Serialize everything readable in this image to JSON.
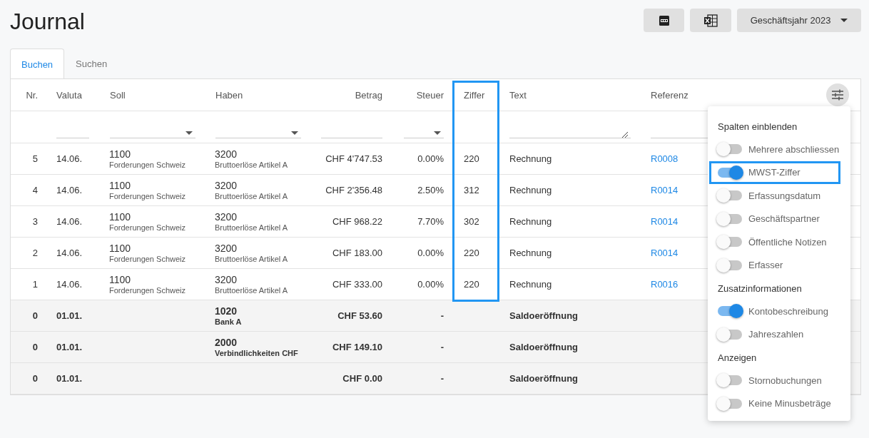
{
  "page": {
    "title": "Journal"
  },
  "toolbar": {
    "year_select": "Geschäftsjahr 2023"
  },
  "tabs": [
    {
      "label": "Buchen",
      "selected": true
    },
    {
      "label": "Suchen",
      "selected": false
    }
  ],
  "table": {
    "columns": [
      {
        "label": "Nr.",
        "kind": "none",
        "highlighted": false
      },
      {
        "label": "Valuta",
        "kind": "text",
        "highlighted": false
      },
      {
        "label": "Soll",
        "kind": "select",
        "highlighted": false
      },
      {
        "label": "Haben",
        "kind": "select",
        "highlighted": false
      },
      {
        "label": "Betrag",
        "kind": "text",
        "highlighted": false
      },
      {
        "label": "Steuer",
        "kind": "select",
        "highlighted": false
      },
      {
        "label": "Ziffer",
        "kind": "none",
        "highlighted": true
      },
      {
        "label": "Text",
        "kind": "textarea",
        "highlighted": false
      },
      {
        "label": "Referenz",
        "kind": "text",
        "highlighted": false
      }
    ],
    "rows": [
      {
        "kind": "entry",
        "nr": "5",
        "valuta": "14.06.",
        "soll": {
          "number": "1100",
          "name": "Forderungen Schweiz"
        },
        "haben": {
          "number": "3200",
          "name": "Bruttoerlöse Artikel A"
        },
        "betrag": "CHF 4'747.53",
        "steuer": "0.00%",
        "ziffer": "220",
        "text": "Rechnung",
        "referenz": "R0008"
      },
      {
        "kind": "entry",
        "nr": "4",
        "valuta": "14.06.",
        "soll": {
          "number": "1100",
          "name": "Forderungen Schweiz"
        },
        "haben": {
          "number": "3200",
          "name": "Bruttoerlöse Artikel A"
        },
        "betrag": "CHF 2'356.48",
        "steuer": "2.50%",
        "ziffer": "312",
        "text": "Rechnung",
        "referenz": "R0014"
      },
      {
        "kind": "entry",
        "nr": "3",
        "valuta": "14.06.",
        "soll": {
          "number": "1100",
          "name": "Forderungen Schweiz"
        },
        "haben": {
          "number": "3200",
          "name": "Bruttoerlöse Artikel A"
        },
        "betrag": "CHF 968.22",
        "steuer": "7.70%",
        "ziffer": "302",
        "text": "Rechnung",
        "referenz": "R0014"
      },
      {
        "kind": "entry",
        "nr": "2",
        "valuta": "14.06.",
        "soll": {
          "number": "1100",
          "name": "Forderungen Schweiz"
        },
        "haben": {
          "number": "3200",
          "name": "Bruttoerlöse Artikel A"
        },
        "betrag": "CHF 183.00",
        "steuer": "0.00%",
        "ziffer": "220",
        "text": "Rechnung",
        "referenz": "R0014"
      },
      {
        "kind": "entry",
        "nr": "1",
        "valuta": "14.06.",
        "soll": {
          "number": "1100",
          "name": "Forderungen Schweiz"
        },
        "haben": {
          "number": "3200",
          "name": "Bruttoerlöse Artikel A"
        },
        "betrag": "CHF 333.00",
        "steuer": "0.00%",
        "ziffer": "220",
        "text": "Rechnung",
        "referenz": "R0016"
      },
      {
        "kind": "opening",
        "nr": "0",
        "valuta": "01.01.",
        "haben": {
          "number": "1020",
          "name": "Bank A"
        },
        "betrag": "CHF 53.60",
        "steuer": "-",
        "text": "Saldoeröffnung"
      },
      {
        "kind": "opening",
        "nr": "0",
        "valuta": "01.01.",
        "haben": {
          "number": "2000",
          "name": "Verbindlichkeiten CHF"
        },
        "betrag": "CHF 149.10",
        "steuer": "-",
        "text": "Saldoeröffnung"
      },
      {
        "kind": "opening",
        "nr": "0",
        "valuta": "01.01.",
        "betrag": "CHF 0.00",
        "steuer": "-",
        "text": "Saldoeröffnung"
      }
    ]
  },
  "column_menu": {
    "sections": [
      {
        "title": "Spalten einblenden",
        "items": [
          {
            "label": "Mehrere abschliessen",
            "on": false,
            "highlighted": false
          },
          {
            "label": "MWST-Ziffer",
            "on": true,
            "highlighted": true
          },
          {
            "label": "Erfassungsdatum",
            "on": false,
            "highlighted": false
          },
          {
            "label": "Geschäftspartner",
            "on": false,
            "highlighted": false
          },
          {
            "label": "Öffentliche Notizen",
            "on": false,
            "highlighted": false
          },
          {
            "label": "Erfasser",
            "on": false,
            "highlighted": false
          }
        ]
      },
      {
        "title": "Zusatzinformationen",
        "items": [
          {
            "label": "Kontobeschreibung",
            "on": true,
            "highlighted": false
          },
          {
            "label": "Jahreszahlen",
            "on": false,
            "highlighted": false
          }
        ]
      },
      {
        "title": "Anzeigen",
        "items": [
          {
            "label": "Stornobuchungen",
            "on": false,
            "highlighted": false
          },
          {
            "label": "Keine Minusbeträge",
            "on": false,
            "highlighted": false
          }
        ]
      }
    ]
  }
}
